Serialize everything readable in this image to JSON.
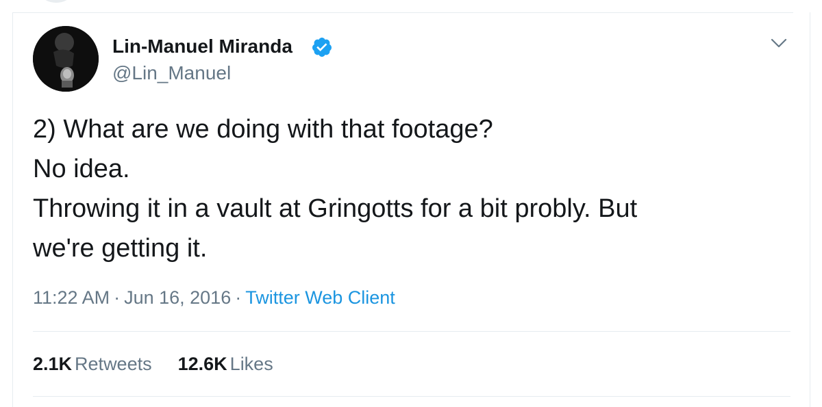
{
  "author": {
    "name": "Lin-Manuel Miranda",
    "handle": "@Lin_Manuel",
    "verified": true,
    "avatar_icon": "profile-photo"
  },
  "tweet": {
    "lines": [
      "2) What are we doing with that footage?",
      "No idea.",
      "Throwing it in a vault at Gringotts for a bit probly. But",
      "we're getting it."
    ],
    "time": "11:22 AM",
    "date": "Jun 16, 2016",
    "separator": "·",
    "client": "Twitter Web Client"
  },
  "stats": {
    "retweets_count": "2.1K",
    "retweets_label": "Retweets",
    "likes_count": "12.6K",
    "likes_label": "Likes"
  },
  "colors": {
    "text": "#14171a",
    "secondary": "#657786",
    "link": "#1b95e0",
    "verified": "#1da1f2",
    "border": "#e6ecf0"
  },
  "icons": {
    "verified": "verified-badge-icon",
    "menu": "chevron-down-icon"
  }
}
